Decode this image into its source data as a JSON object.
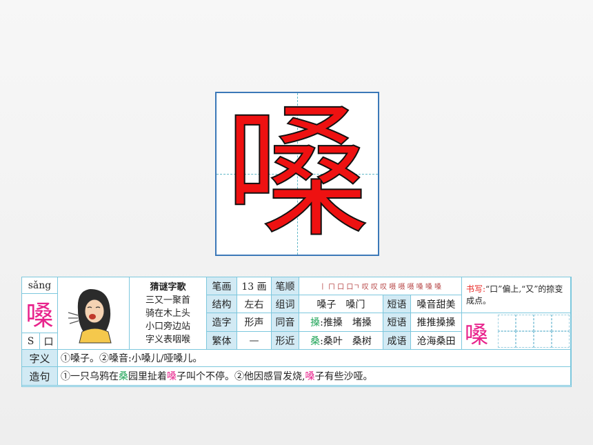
{
  "main_character": "嗓",
  "card": {
    "pinyin": "sǎng",
    "character": "嗓",
    "initial": "S",
    "radical": "口",
    "riddle": {
      "title": "猜谜字歌",
      "lines": [
        "三又一聚首",
        "骑在木上头",
        "小口旁边站",
        "字义表咽喉"
      ]
    },
    "rows": {
      "stroke_count_label": "笔画",
      "stroke_count": "13 画",
      "stroke_order_label": "笔顺",
      "stroke_order": "丨 ㄇ 口 口ㄱ 叹 叹 叹 嗫 嗫 嗫 嗓 嗓 嗓",
      "structure_label": "结构",
      "structure": "左右",
      "word_label": "组词",
      "words": "嗓子　嗓门",
      "phrase_label": "短语",
      "phrase1": "嗓音甜美",
      "phrase2": "推推搡搡",
      "formation_label": "造字",
      "formation": "形声",
      "homophone_label": "同音",
      "homophone_char": "搡",
      "homophone_words": ":推搡　堵搡",
      "traditional_label": "繁体",
      "traditional": "—",
      "similar_label": "形近",
      "similar_char": "桑",
      "similar_words": ":桑叶　桑树",
      "idiom_label": "成语",
      "idiom": "沧海桑田"
    },
    "writing_label": "书写:",
    "writing_tip": "“口”偏上,“又”的捺变成点。",
    "practice_char": "嗓",
    "meaning_label": "字义",
    "meaning": "①嗓子。②嗓音:小嗓儿/哑嗓儿。",
    "sentence_label": "造句",
    "sentence_parts": {
      "p1": "①一只乌鸦在",
      "k1": "桑",
      "p2": "园里扯着",
      "k2": "嗓",
      "p3": "子叫个不停。②他因感冒发烧,",
      "k3": "嗓",
      "p4": "子有些沙哑。"
    }
  }
}
